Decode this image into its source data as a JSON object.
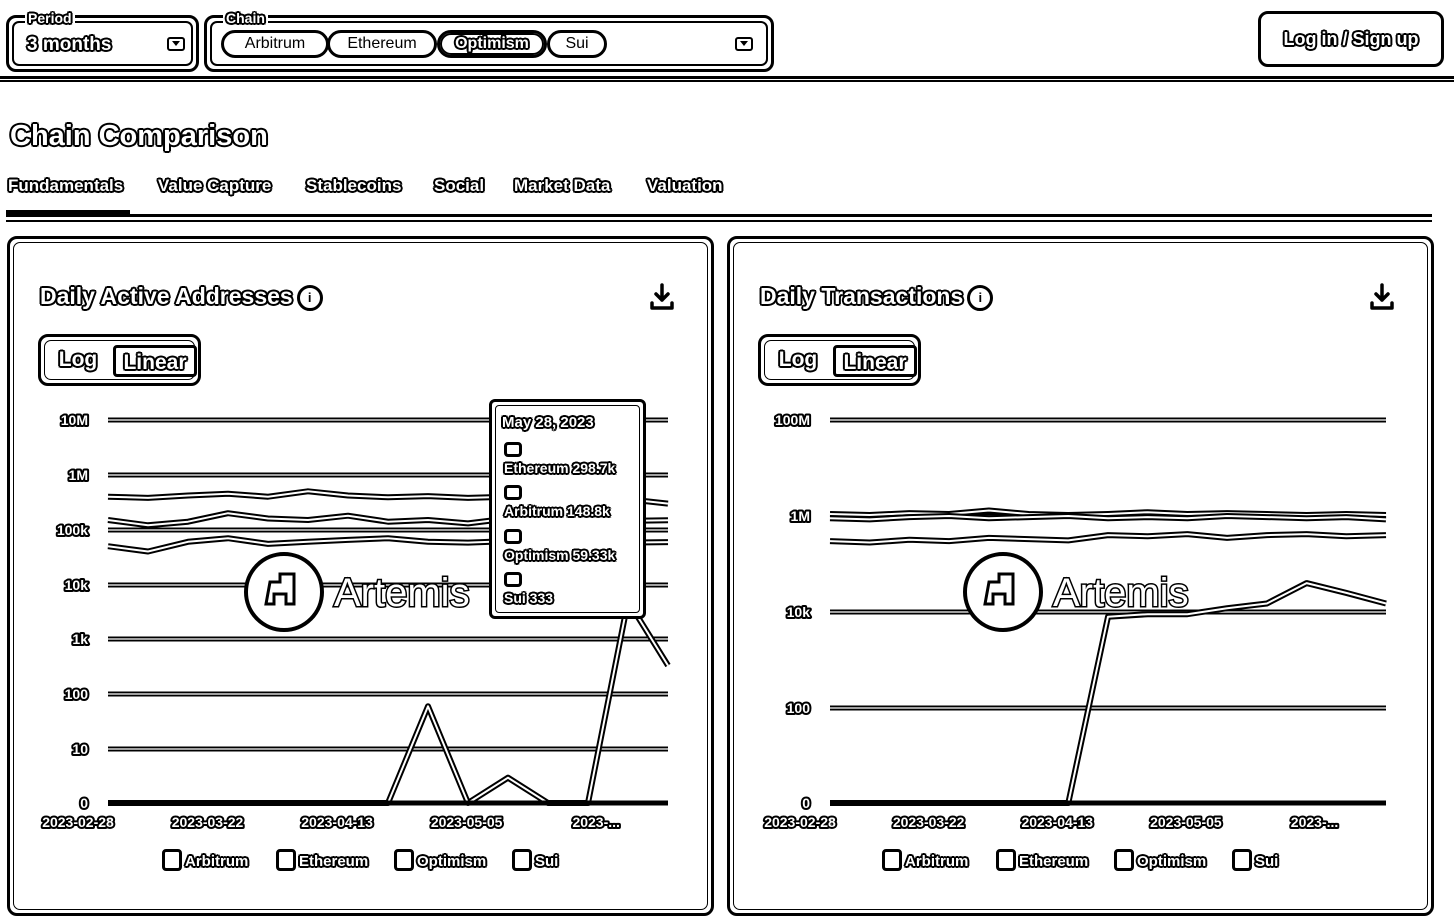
{
  "header": {
    "period": {
      "legend": "Period",
      "value": "3 months"
    },
    "chain": {
      "legend": "Chain",
      "chips": [
        {
          "label": "Arbitrum",
          "selected": false
        },
        {
          "label": "Ethereum",
          "selected": false
        },
        {
          "label": "Optimism",
          "selected": true
        },
        {
          "label": "Sui",
          "selected": false
        }
      ]
    },
    "login_label": "Log in / Sign up"
  },
  "page_title": "Chain Comparison",
  "tabs": [
    {
      "label": "Fundamentals",
      "active": true
    },
    {
      "label": "Value Capture",
      "active": false
    },
    {
      "label": "Stablecoins",
      "active": false
    },
    {
      "label": "Social",
      "active": false
    },
    {
      "label": "Market Data",
      "active": false
    },
    {
      "label": "Valuation",
      "active": false
    }
  ],
  "cards": [
    {
      "title": "Daily Active Addresses",
      "info_icon": "info-icon",
      "download_icon": "download-icon",
      "scale_toggle": {
        "log_label": "Log",
        "linear_label": "Linear",
        "active": "Linear"
      },
      "watermark": "Artemis",
      "legend": [
        "Arbitrum",
        "Ethereum",
        "Optimism",
        "Sui"
      ]
    },
    {
      "title": "Daily Transactions",
      "info_icon": "info-icon",
      "download_icon": "download-icon",
      "scale_toggle": {
        "log_label": "Log",
        "linear_label": "Linear",
        "active": "Linear"
      },
      "watermark": "Artemis",
      "legend": [
        "Arbitrum",
        "Ethereum",
        "Optimism",
        "Sui"
      ]
    }
  ],
  "tooltip": {
    "date": "May 28, 2023",
    "rows": [
      {
        "label": "Ethereum 298.7k"
      },
      {
        "label": "Arbitrum 148.8k"
      },
      {
        "label": "Optimism 59.33k"
      },
      {
        "label": "Sui 333"
      }
    ]
  },
  "chart_data": [
    {
      "type": "line",
      "title": "Daily Active Addresses",
      "y_ticks": [
        "10M",
        "1M",
        "100k",
        "10k",
        "1k",
        "100",
        "10",
        "0"
      ],
      "x_ticks": [
        "2023-02-28",
        "2023-03-22",
        "2023-04-13",
        "2023-05-05",
        "2023-..."
      ],
      "y_scale": "log",
      "series": [
        {
          "name": "Ethereum",
          "values": [
            400000,
            380000,
            420000,
            450000,
            400000,
            500000,
            420000,
            390000,
            410000,
            380000,
            400000,
            350000,
            370000,
            360000,
            298700
          ]
        },
        {
          "name": "Arbitrum",
          "values": [
            150000,
            120000,
            140000,
            200000,
            160000,
            150000,
            180000,
            140000,
            150000,
            130000,
            160000,
            140000,
            150000,
            145000,
            148800
          ]
        },
        {
          "name": "Optimism",
          "values": [
            50000,
            40000,
            60000,
            70000,
            55000,
            60000,
            65000,
            70000,
            60000,
            58000,
            62000,
            55000,
            60000,
            58000,
            59330
          ]
        },
        {
          "name": "Sui",
          "values": [
            0,
            0,
            0,
            0,
            0,
            0,
            0,
            0,
            60,
            0,
            3,
            0,
            0,
            5000,
            333
          ]
        }
      ]
    },
    {
      "type": "line",
      "title": "Daily Transactions",
      "y_ticks": [
        "100M",
        "1M",
        "10k",
        "100",
        "0"
      ],
      "x_ticks": [
        "2023-02-28",
        "2023-03-22",
        "2023-04-13",
        "2023-05-05",
        "2023-..."
      ],
      "y_scale": "log",
      "series": [
        {
          "name": "Ethereum",
          "values": [
            1100000,
            1050000,
            1150000,
            1100000,
            1300000,
            1100000,
            1050000,
            1100000,
            1200000,
            1100000,
            1150000,
            1100000,
            1050000,
            1100000,
            1050000
          ]
        },
        {
          "name": "Arbitrum",
          "values": [
            900000,
            850000,
            950000,
            1000000,
            900000,
            950000,
            1000000,
            900000,
            950000,
            900000,
            1000000,
            950000,
            900000,
            950000,
            850000
          ]
        },
        {
          "name": "Optimism",
          "values": [
            300000,
            280000,
            320000,
            300000,
            350000,
            330000,
            310000,
            400000,
            380000,
            420000,
            350000,
            400000,
            420000,
            380000,
            400000
          ]
        },
        {
          "name": "Sui",
          "values": [
            0,
            0,
            0,
            0,
            0,
            0,
            0,
            8000,
            9000,
            9000,
            12000,
            15000,
            40000,
            25000,
            15000
          ]
        }
      ]
    }
  ]
}
